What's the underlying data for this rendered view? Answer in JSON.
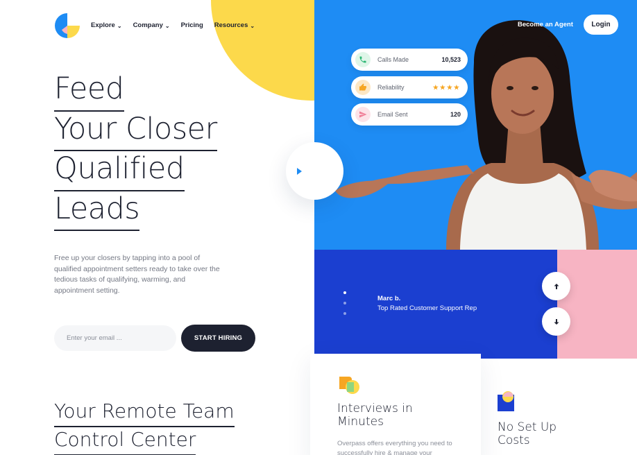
{
  "nav": {
    "items": [
      {
        "label": "Explore",
        "dropdown": true
      },
      {
        "label": "Company",
        "dropdown": true
      },
      {
        "label": "Pricing",
        "dropdown": false
      },
      {
        "label": "Resources",
        "dropdown": true
      }
    ],
    "become_agent": "Become an Agent",
    "login": "Login"
  },
  "hero": {
    "title_lines": [
      "Feed",
      "Your Closer",
      "Qualified",
      "Leads"
    ],
    "description": "Free up your closers by tapping into a pool of qualified appointment setters ready to take over the tedious tasks of qualifying, warming, and appointment setting.",
    "email_placeholder": "Enter your email ...",
    "cta": "START HIRING"
  },
  "stats": [
    {
      "label": "Calls Made",
      "value": "10,523",
      "icon": "phone-icon",
      "icon_bg": "#dff6e8",
      "icon_color": "#2bb673"
    },
    {
      "label": "Reliability",
      "value": "★★★★",
      "icon": "thumbs-up-icon",
      "icon_bg": "#fde7c4",
      "icon_color": "#f6a623"
    },
    {
      "label": "Email Sent",
      "value": "120",
      "icon": "paper-plane-icon",
      "icon_bg": "#fde3e8",
      "icon_color": "#f07f98"
    }
  ],
  "testimonial": {
    "name": "Marc b.",
    "role": "Top Rated Customer Support Rep"
  },
  "section": {
    "title_lines": [
      "Your Remote Team",
      "Control Center"
    ]
  },
  "features": [
    {
      "title": "Interviews in Minutes",
      "description": "Overpass offers everything you need to successfully hire & manage your"
    },
    {
      "title": "No Set Up Costs"
    }
  ],
  "colors": {
    "blue": "#1e8cf4",
    "navy": "#1b3fd0",
    "yellow": "#fcd94b",
    "pink": "#f7b4c3",
    "dark": "#1d2130"
  }
}
